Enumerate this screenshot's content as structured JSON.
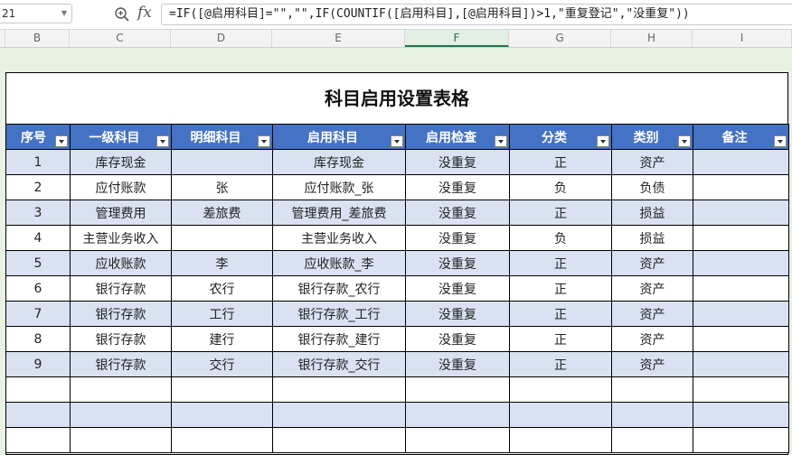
{
  "formula_bar": {
    "cell_ref": "21",
    "formula": "=IF([@启用科目]=\"\",\"\",IF(COUNTIF([启用科目],[@启用科目])>1,\"重复登记\",\"没重复\"))"
  },
  "columns": [
    "B",
    "C",
    "D",
    "E",
    "F",
    "G",
    "H",
    "I"
  ],
  "table": {
    "title": "科目启用设置表格",
    "headers": [
      "序号",
      "一级科目",
      "明细科目",
      "启用科目",
      "启用检查",
      "分类",
      "类别",
      "备注"
    ],
    "rows": [
      [
        "1",
        "库存现金",
        "",
        "库存现金",
        "没重复",
        "正",
        "资产",
        ""
      ],
      [
        "2",
        "应付账款",
        "张",
        "应付账款_张",
        "没重复",
        "负",
        "负债",
        ""
      ],
      [
        "3",
        "管理费用",
        "差旅费",
        "管理费用_差旅费",
        "没重复",
        "正",
        "损益",
        ""
      ],
      [
        "4",
        "主营业务收入",
        "",
        "主营业务收入",
        "没重复",
        "负",
        "损益",
        ""
      ],
      [
        "5",
        "应收账款",
        "李",
        "应收账款_李",
        "没重复",
        "正",
        "资产",
        ""
      ],
      [
        "6",
        "银行存款",
        "农行",
        "银行存款_农行",
        "没重复",
        "正",
        "资产",
        ""
      ],
      [
        "7",
        "银行存款",
        "工行",
        "银行存款_工行",
        "没重复",
        "正",
        "资产",
        ""
      ],
      [
        "8",
        "银行存款",
        "建行",
        "银行存款_建行",
        "没重复",
        "正",
        "资产",
        ""
      ],
      [
        "9",
        "银行存款",
        "交行",
        "银行存款_交行",
        "没重复",
        "正",
        "资产",
        ""
      ],
      [
        "",
        "",
        "",
        "",
        "",
        "",
        "",
        ""
      ],
      [
        "",
        "",
        "",
        "",
        "",
        "",
        "",
        ""
      ],
      [
        "",
        "",
        "",
        "",
        "",
        "",
        "",
        ""
      ]
    ]
  },
  "colors": {
    "header_fill": "#4472c4",
    "band_fill": "#d9e1f2",
    "sheet_bg": "#e9f1e4",
    "active_column": "#217346"
  },
  "icons": {
    "zoom": "zoom-formula-icon",
    "fx": "insert-function-icon",
    "filter": "filter-dropdown-icon"
  }
}
